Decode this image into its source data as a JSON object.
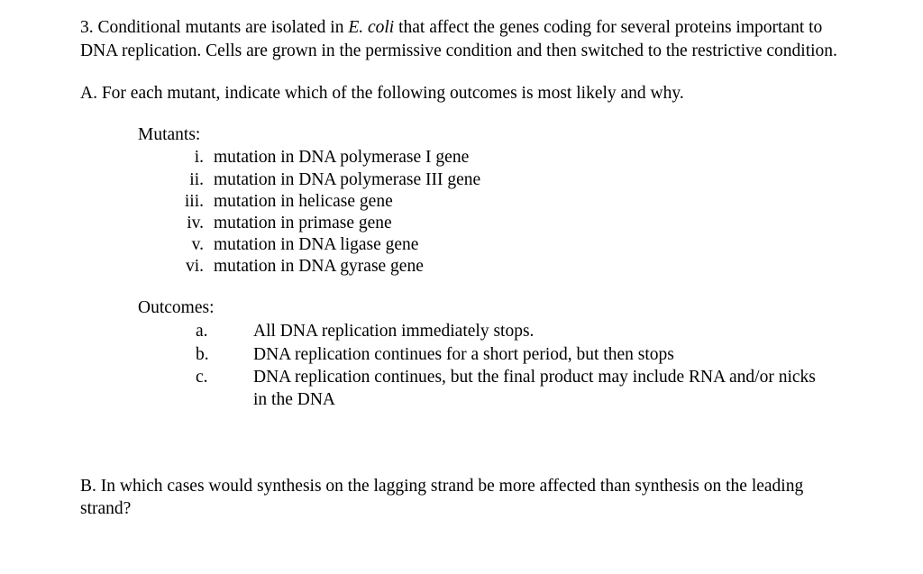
{
  "document": {
    "question_number": "3.",
    "intro": {
      "before_italic": "3. Conditional mutants are isolated in ",
      "italic": "E. coli",
      "after_italic": " that affect the genes coding for several proteins important to DNA replication.  Cells are grown in the permissive condition and then switched to the restrictive condition."
    },
    "part_a": {
      "prompt": "A. For each mutant, indicate which of the following outcomes is most likely and why.",
      "mutants": {
        "heading": "Mutants:",
        "items": [
          {
            "marker": "i.",
            "text": "mutation in DNA polymerase I gene"
          },
          {
            "marker": "ii.",
            "text": "mutation in DNA polymerase III gene"
          },
          {
            "marker": "iii.",
            "text": "mutation in helicase gene"
          },
          {
            "marker": "iv.",
            "text": "mutation in primase gene"
          },
          {
            "marker": "v.",
            "text": "mutation in DNA ligase gene"
          },
          {
            "marker": "vi.",
            "text": "mutation in DNA gyrase gene"
          }
        ]
      },
      "outcomes": {
        "heading": "Outcomes:",
        "items": [
          {
            "marker": "a.",
            "text": "All DNA replication immediately stops."
          },
          {
            "marker": "b.",
            "text": "DNA replication continues for a short period, but then stops"
          },
          {
            "marker": "c.",
            "text": "DNA replication continues, but the final product may include RNA and/or nicks in the DNA"
          }
        ]
      }
    },
    "part_b": {
      "prompt": "B. In which cases would synthesis on the lagging strand be more affected than synthesis on the leading strand?"
    }
  }
}
